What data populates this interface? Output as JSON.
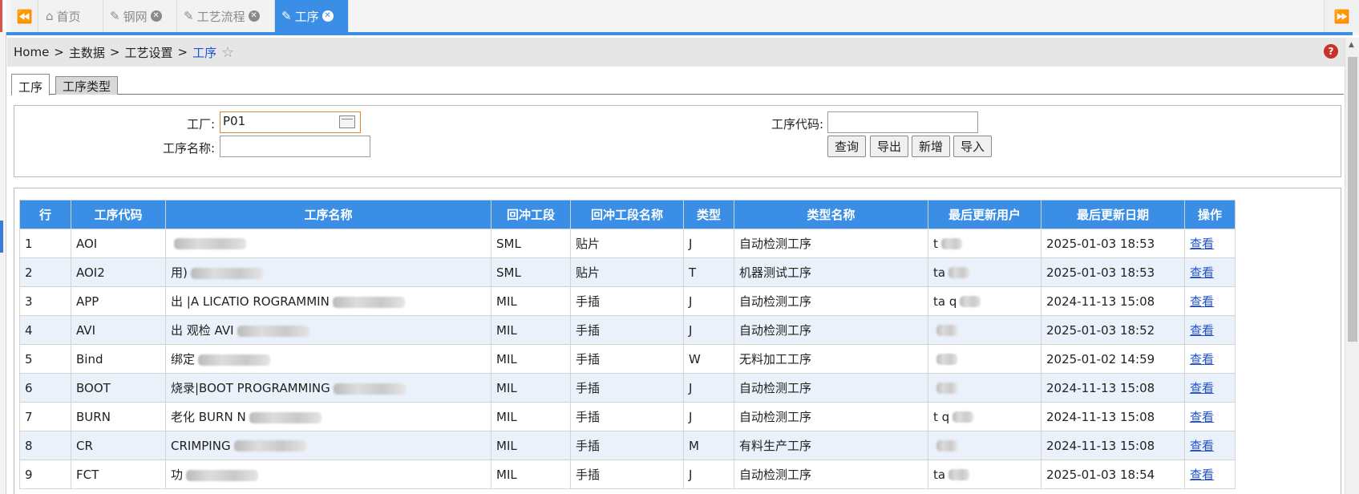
{
  "tabs": {
    "items": [
      {
        "label": "首页",
        "icon": "home-icon",
        "closable": false,
        "active": false
      },
      {
        "label": "钢网",
        "icon": "edit-icon",
        "closable": true,
        "active": false
      },
      {
        "label": "工艺流程",
        "icon": "edit-icon",
        "closable": true,
        "active": false
      },
      {
        "label": "工序",
        "icon": "edit-icon",
        "closable": true,
        "active": true
      }
    ]
  },
  "breadcrumb": {
    "home": "Home",
    "sep": ">",
    "level1": "主数据",
    "level2": "工艺设置",
    "current": "工序"
  },
  "inner_tabs": [
    "工序",
    "工序类型"
  ],
  "filter": {
    "factory_label": "工厂:",
    "factory_value": "P01",
    "code_label": "工序代码:",
    "code_value": "",
    "name_label": "工序名称:",
    "name_value": "",
    "buttons": {
      "query": "查询",
      "export": "导出",
      "add": "新增",
      "import": "导入"
    }
  },
  "table": {
    "headers": [
      "行",
      "工序代码",
      "工序名称",
      "回冲工段",
      "回冲工段名称",
      "类型",
      "类型名称",
      "最后更新用户",
      "最后更新日期",
      "操作"
    ],
    "rows": [
      {
        "row": "1",
        "code": "AOI",
        "name": "",
        "seg": "SML",
        "seg_name": "贴片",
        "type": "J",
        "type_name": "自动检测工序",
        "user": "t",
        "date": "2025-01-03 18:53",
        "action": "查看"
      },
      {
        "row": "2",
        "code": "AOI2",
        "name": "用)",
        "seg": "SML",
        "seg_name": "贴片",
        "type": "T",
        "type_name": "机器测试工序",
        "user": "ta",
        "date": "2025-01-03 18:53",
        "action": "查看"
      },
      {
        "row": "3",
        "code": "APP",
        "name": "出 |A LICATIO ROGRAMMIN",
        "seg": "MIL",
        "seg_name": "手插",
        "type": "J",
        "type_name": "自动检测工序",
        "user": "ta q",
        "date": "2024-11-13 15:08",
        "action": "查看"
      },
      {
        "row": "4",
        "code": "AVI",
        "name": "出 观检 AVI",
        "seg": "MIL",
        "seg_name": "手插",
        "type": "J",
        "type_name": "自动检测工序",
        "user": "",
        "date": "2025-01-03 18:52",
        "action": "查看"
      },
      {
        "row": "5",
        "code": "Bind",
        "name": "绑定",
        "seg": "MIL",
        "seg_name": "手插",
        "type": "W",
        "type_name": "无料加工工序",
        "user": "",
        "date": "2025-01-02 14:59",
        "action": "查看"
      },
      {
        "row": "6",
        "code": "BOOT",
        "name": "烧录|BOOT PROGRAMMING",
        "seg": "MIL",
        "seg_name": "手插",
        "type": "J",
        "type_name": "自动检测工序",
        "user": "",
        "date": "2024-11-13 15:08",
        "action": "查看"
      },
      {
        "row": "7",
        "code": "BURN",
        "name": "老化 BURN N",
        "seg": "MIL",
        "seg_name": "手插",
        "type": "J",
        "type_name": "自动检测工序",
        "user": "t q",
        "date": "2024-11-13 15:08",
        "action": "查看"
      },
      {
        "row": "8",
        "code": "CR",
        "name": "CRIMPING",
        "seg": "MIL",
        "seg_name": "手插",
        "type": "M",
        "type_name": "有料生产工序",
        "user": "",
        "date": "2024-11-13 15:08",
        "action": "查看"
      },
      {
        "row": "9",
        "code": "FCT",
        "name": "功",
        "seg": "MIL",
        "seg_name": "手插",
        "type": "J",
        "type_name": "自动检测工序",
        "user": "ta",
        "date": "2025-01-03 18:54",
        "action": "查看"
      }
    ]
  },
  "colors": {
    "accent": "#3a8ee6",
    "link": "#2050d8",
    "row_alt": "#eaf1fb"
  }
}
